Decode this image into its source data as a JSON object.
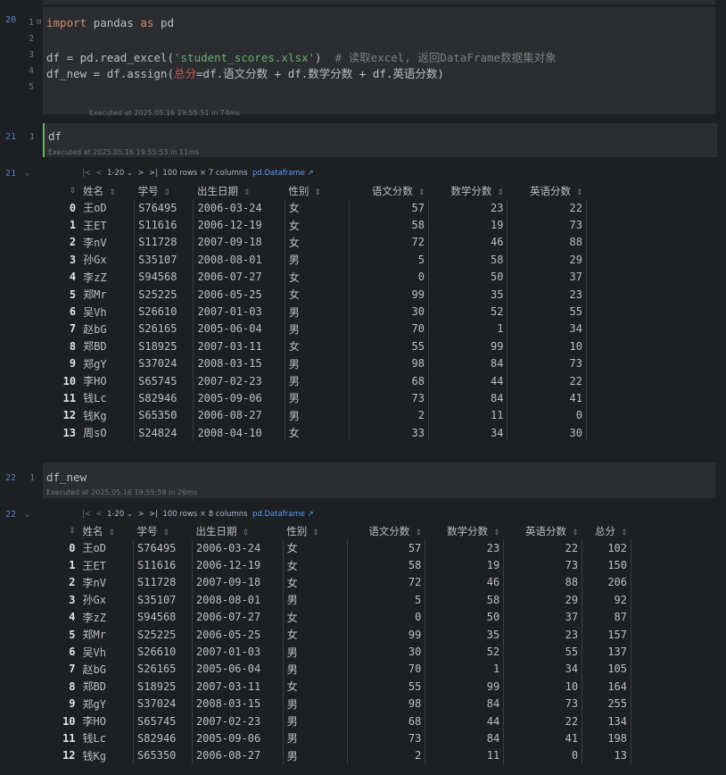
{
  "cell20": {
    "id": "20",
    "lines": [
      {
        "no": "1",
        "parts": [
          {
            "t": "import",
            "c": "kw"
          },
          {
            "t": " pandas "
          },
          {
            "t": "as",
            "c": "kw"
          },
          {
            "t": " pd"
          }
        ]
      },
      {
        "no": "2",
        "parts": []
      },
      {
        "no": "3",
        "parts": [
          {
            "t": "df = pd.read_excel("
          },
          {
            "t": "'student_scores.xlsx'",
            "c": "str"
          },
          {
            "t": ")  "
          },
          {
            "t": "# 读取excel, 返回DataFrame数据集对象",
            "c": "cmt"
          }
        ]
      },
      {
        "no": "4",
        "parts": [
          {
            "t": "df_new = df.assign("
          },
          {
            "t": "总分",
            "c": "hl"
          },
          {
            "t": "=df.语文分数 + df.数学分数 + df.英语分数)"
          }
        ]
      },
      {
        "no": "5",
        "parts": []
      }
    ],
    "exec": "Executed at 2025.05.16 19:55:51 in 74ms"
  },
  "cell21": {
    "id": "21",
    "line_no": "1",
    "code": "df",
    "exec": "Executed at 2025.05.16 19:55:53 in 11ms"
  },
  "out21": {
    "id": "21",
    "toolbar": {
      "range": "1-20",
      "rows": "100 rows × 7 columns",
      "type": "pd.Dataframe ↗"
    },
    "columns": [
      "姓名",
      "学号",
      "出生日期",
      "性别",
      "语文分数",
      "数学分数",
      "英语分数"
    ],
    "rows": [
      [
        "0",
        "王oD",
        "S76495",
        "2006-03-24",
        "女",
        "57",
        "23",
        "22"
      ],
      [
        "1",
        "王ET",
        "S11616",
        "2006-12-19",
        "女",
        "58",
        "19",
        "73"
      ],
      [
        "2",
        "李nV",
        "S11728",
        "2007-09-18",
        "女",
        "72",
        "46",
        "88"
      ],
      [
        "3",
        "孙Gx",
        "S35107",
        "2008-08-01",
        "男",
        "5",
        "58",
        "29"
      ],
      [
        "4",
        "李zZ",
        "S94568",
        "2006-07-27",
        "女",
        "0",
        "50",
        "37"
      ],
      [
        "5",
        "郑Mr",
        "S25225",
        "2006-05-25",
        "女",
        "99",
        "35",
        "23"
      ],
      [
        "6",
        "吴Vh",
        "S26610",
        "2007-01-03",
        "男",
        "30",
        "52",
        "55"
      ],
      [
        "7",
        "赵bG",
        "S26165",
        "2005-06-04",
        "男",
        "70",
        "1",
        "34"
      ],
      [
        "8",
        "郑BD",
        "S18925",
        "2007-03-11",
        "女",
        "55",
        "99",
        "10"
      ],
      [
        "9",
        "郑gY",
        "S37024",
        "2008-03-15",
        "男",
        "98",
        "84",
        "73"
      ],
      [
        "10",
        "李HO",
        "S65745",
        "2007-02-23",
        "男",
        "68",
        "44",
        "22"
      ],
      [
        "11",
        "钱Lc",
        "S82946",
        "2005-09-06",
        "男",
        "73",
        "84",
        "41"
      ],
      [
        "12",
        "钱Kg",
        "S65350",
        "2006-08-27",
        "男",
        "2",
        "11",
        "0"
      ],
      [
        "13",
        "周sO",
        "S24824",
        "2008-04-10",
        "女",
        "33",
        "34",
        "30"
      ]
    ]
  },
  "cell22": {
    "id": "22",
    "line_no": "1",
    "code": "df_new",
    "exec": "Executed at 2025.05.16 19:55:59 in 26ms"
  },
  "out22": {
    "id": "22",
    "toolbar": {
      "range": "1-20",
      "rows": "100 rows × 8 columns",
      "type": "pd.Dataframe ↗"
    },
    "columns": [
      "姓名",
      "学号",
      "出生日期",
      "性别",
      "语文分数",
      "数学分数",
      "英语分数",
      "总分"
    ],
    "rows": [
      [
        "0",
        "王oD",
        "S76495",
        "2006-03-24",
        "女",
        "57",
        "23",
        "22",
        "102"
      ],
      [
        "1",
        "王ET",
        "S11616",
        "2006-12-19",
        "女",
        "58",
        "19",
        "73",
        "150"
      ],
      [
        "2",
        "李nV",
        "S11728",
        "2007-09-18",
        "女",
        "72",
        "46",
        "88",
        "206"
      ],
      [
        "3",
        "孙Gx",
        "S35107",
        "2008-08-01",
        "男",
        "5",
        "58",
        "29",
        "92"
      ],
      [
        "4",
        "李zZ",
        "S94568",
        "2006-07-27",
        "女",
        "0",
        "50",
        "37",
        "87"
      ],
      [
        "5",
        "郑Mr",
        "S25225",
        "2006-05-25",
        "女",
        "99",
        "35",
        "23",
        "157"
      ],
      [
        "6",
        "吴Vh",
        "S26610",
        "2007-01-03",
        "男",
        "30",
        "52",
        "55",
        "137"
      ],
      [
        "7",
        "赵bG",
        "S26165",
        "2005-06-04",
        "男",
        "70",
        "1",
        "34",
        "105"
      ],
      [
        "8",
        "郑BD",
        "S18925",
        "2007-03-11",
        "女",
        "55",
        "99",
        "10",
        "164"
      ],
      [
        "9",
        "郑gY",
        "S37024",
        "2008-03-15",
        "男",
        "98",
        "84",
        "73",
        "255"
      ],
      [
        "10",
        "李HO",
        "S65745",
        "2007-02-23",
        "男",
        "68",
        "44",
        "22",
        "134"
      ],
      [
        "11",
        "钱Lc",
        "S82946",
        "2005-09-06",
        "男",
        "73",
        "84",
        "41",
        "198"
      ],
      [
        "12",
        "钱Kg",
        "S65350",
        "2006-08-27",
        "男",
        "2",
        "11",
        "0",
        "13"
      ]
    ]
  }
}
